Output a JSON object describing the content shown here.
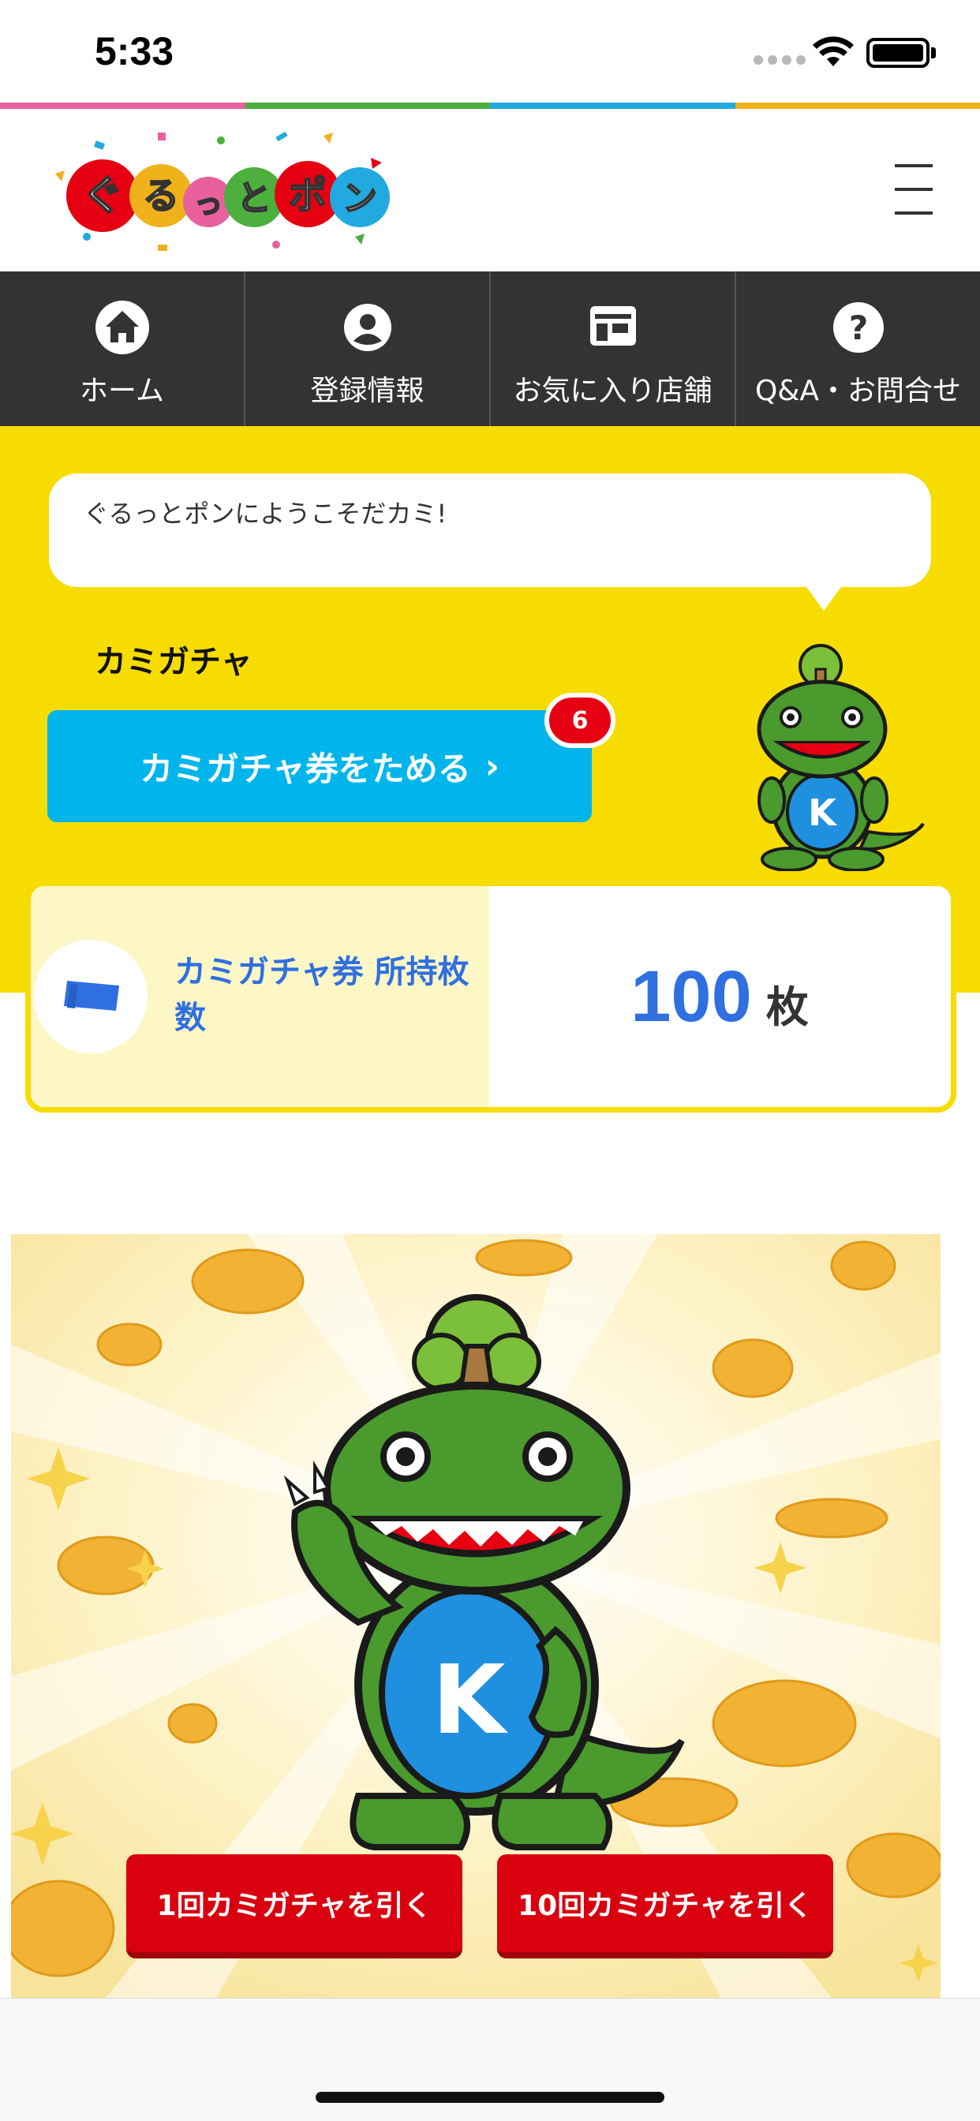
{
  "status_bar": {
    "time": "5:33"
  },
  "brand": {
    "stripe_colors": [
      "#e8609c",
      "#4caf3e",
      "#22a9e0",
      "#f0b21a"
    ],
    "nav_bg": "#333333",
    "yellow": "#f7dc00",
    "blue_button": "#00b5ec",
    "red_button": "#d90010",
    "accent_text": "#2f6fe0"
  },
  "header": {
    "logo_icon": "guruttopon-logo",
    "menu_icon": "hamburger-menu-icon"
  },
  "nav": [
    {
      "label": "ホーム",
      "icon": "home-icon"
    },
    {
      "label": "登録情報",
      "icon": "user-icon"
    },
    {
      "label": "お気に入り店舗",
      "icon": "store-icon"
    },
    {
      "label": "Q&A・お問合せ",
      "icon": "question-icon"
    }
  ],
  "speech": {
    "text": "ぐるっとポンにようこそだカミ!"
  },
  "section": {
    "title": "カミガチャ"
  },
  "collect_button": {
    "label": "カミガチャ券をためる",
    "chevron": "›",
    "badge": "6"
  },
  "ticket": {
    "label": "カミガチャ券 所持枚数",
    "count": "100",
    "unit": "枚"
  },
  "gacha": {
    "buttons": [
      {
        "label": "1回カミガチャを引く"
      },
      {
        "label": "10回カミガチャを引く"
      }
    ]
  }
}
